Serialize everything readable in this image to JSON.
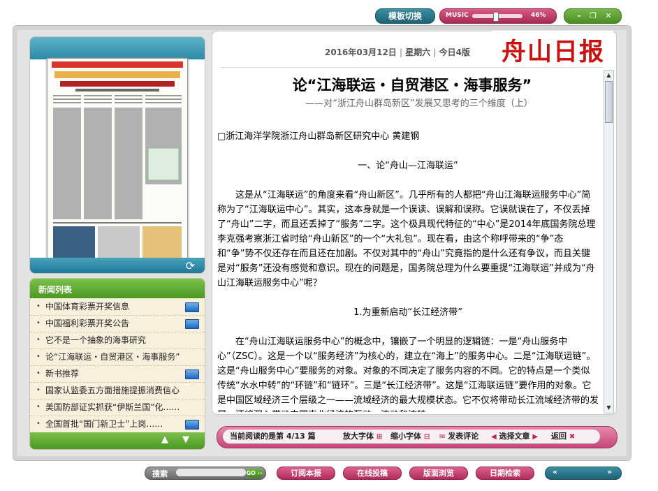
{
  "top": {
    "template_switch": "模板切换",
    "music_label": "MUSIC",
    "music_volume": "46%",
    "music_level": 0.46
  },
  "header": {
    "date": "2016年03月12日",
    "weekday": "星期六",
    "pages": "今日4版",
    "logo": "舟山日报"
  },
  "news": {
    "title": "新闻列表",
    "items": [
      {
        "label": "中国体育彩票开奖信息",
        "icon": true
      },
      {
        "label": "中国福利彩票开奖公告",
        "icon": true
      },
      {
        "label": "它不是一个抽象的海事研究",
        "icon": false
      },
      {
        "label": "论“江海联运・自贸港区・海事服务”",
        "icon": false
      },
      {
        "label": "新书推荐",
        "icon": true
      },
      {
        "label": "国家认监委五方面措施提振消费信心",
        "icon": false
      },
      {
        "label": "美国防部证实抓获“伊斯兰国”化……",
        "icon": false
      },
      {
        "label": "全国首批“国门新卫士”上岗……",
        "icon": true
      }
    ]
  },
  "article": {
    "title": "论“江海联运・自贸港区・海事服务”",
    "subtitle": "——对“浙江舟山群岛新区”发展又思考的三个维度（上）",
    "author": "□浙江海洋学院浙江舟山群岛新区研究中心 黄建钢",
    "section1": "一、论“舟山—江海联运”",
    "para1": "这是从“江海联运”的角度来看“舟山新区”。几乎所有的人都把“舟山江海联运服务中心”简称为了“江海联运中心”。其实，这本身就是一个误读、误解和误称。它误就误在了，不仅丢掉了“舟山”二字，而且还丢掉了“服务”二字。这个极具现代特征的“中心”是2014年底国务院总理李克强考察浙江省时给“舟山新区”的一个“大礼包”。现在看，由这个称呼带来的“争”态和“争”势不仅还存在而且还在加剧。不仅对其中的“舟山”究竟指的是什么还有争议，而且关键是对“服务”还没有感觉和意识。现在的问题是，国务院总理为什么要重提“江海联运”并成为“舟山江海联运服务中心”呢？",
    "section2": "1.为重新启动“长江经济带”",
    "para2": "在“舟山江海联运服务中心”的概念中，镶嵌了一个明显的逻辑链：一是“舟山服务中心”（ZSC）。这是一个以“服务经济”为核心的，建立在“海上”的服务中心。二是“江海联运链”。这是“舟山服务中心”要服务的对象。对象的不同决定了服务内容的不同。它的特点是一个类似传统“水水中转”的“环链”和“链环”。三是“长江经济带”。这是“江海联运链”要作用的对象。它是中国区域经济三个层级之一——流域经济的最大规模状态。它不仅将带动长江流域经济带的发展，还将深入带动中国南北经济的互动，流动和流转。"
  },
  "toolbar": {
    "current_prefix": "当前阅读的是第",
    "current_page": "4/13",
    "current_suffix": "篇",
    "zoom_in": "放大字体",
    "zoom_out": "缩小字体",
    "comment": "发表评论",
    "select": "选择文章",
    "back": "返回"
  },
  "bottom": {
    "search_label": "搜索",
    "search_value": "",
    "go": "GO",
    "subscribe": "订阅本报",
    "submit": "在线投稿",
    "browse": "版面浏览",
    "date_search": "日期检索",
    "prev": "«",
    "next": "»"
  },
  "colors": {
    "teal": "#2a8aa5",
    "pink": "#c5477a",
    "green": "#4b9624",
    "logo_red": "#cc1111"
  }
}
